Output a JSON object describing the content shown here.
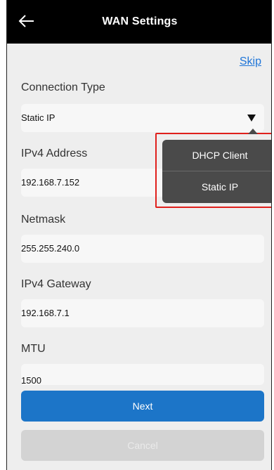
{
  "header": {
    "title": "WAN Settings",
    "back_icon": "arrow-left-icon"
  },
  "skip_label": "Skip",
  "fields": {
    "connection_type": {
      "label": "Connection Type",
      "value": "Static IP"
    },
    "ipv4_address": {
      "label": "IPv4 Address",
      "value": "192.168.7.152"
    },
    "netmask": {
      "label": "Netmask",
      "value": "255.255.240.0"
    },
    "ipv4_gateway": {
      "label": "IPv4 Gateway",
      "value": "192.168.7.1"
    },
    "mtu": {
      "label": "MTU",
      "value": "1500"
    }
  },
  "dropdown_menu": {
    "options": [
      "DHCP Client",
      "Static IP"
    ]
  },
  "buttons": {
    "next": "Next",
    "cancel": "Cancel"
  },
  "colors": {
    "header_bg": "#000000",
    "accent": "#1c75c8",
    "link": "#1e75d8",
    "highlight_border": "#e0201c",
    "menu_bg": "#4a4a4a"
  }
}
